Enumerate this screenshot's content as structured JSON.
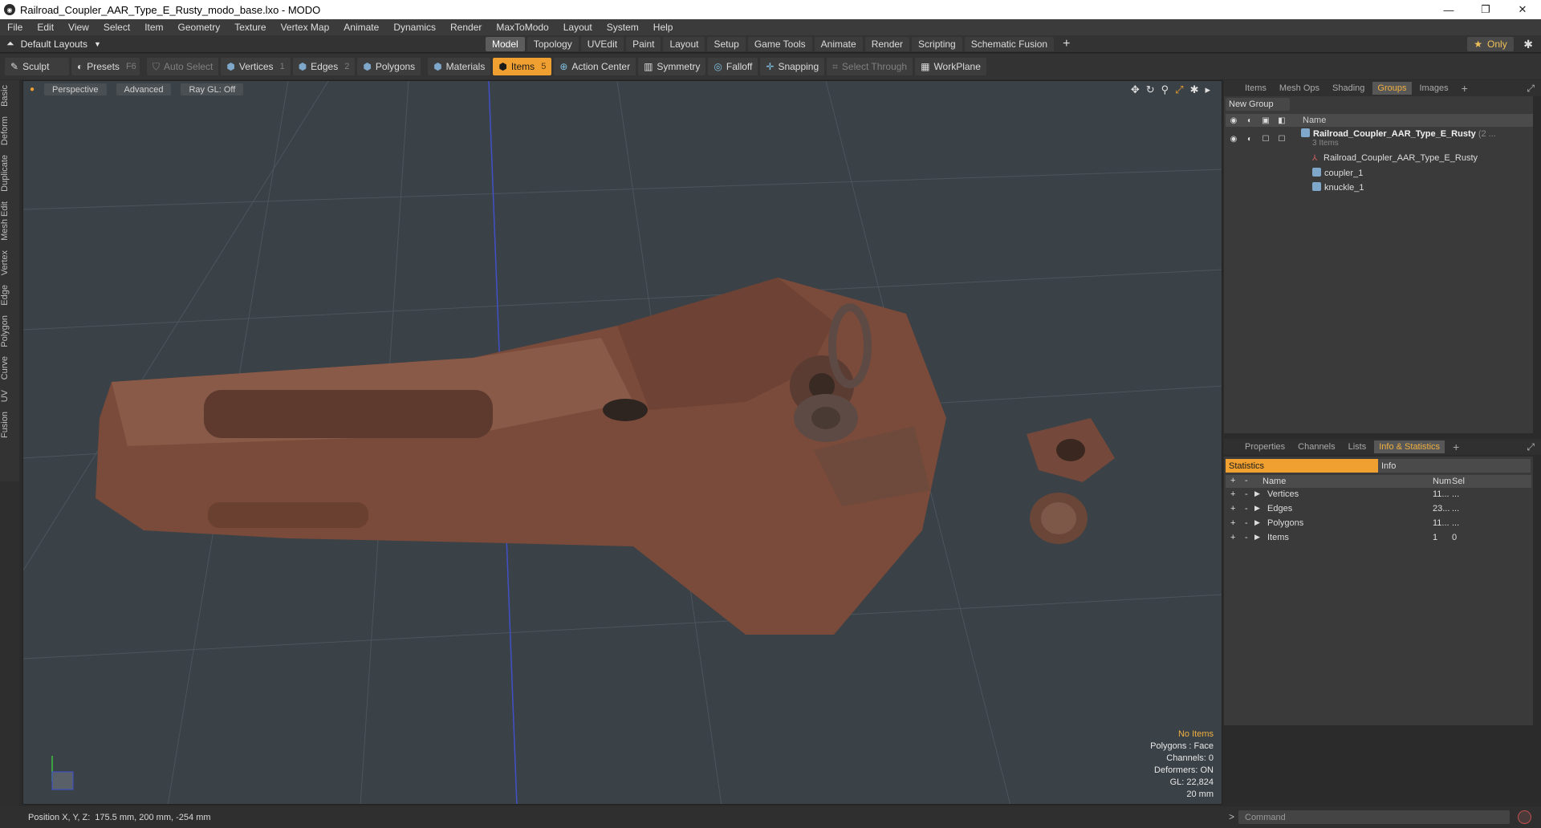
{
  "window": {
    "title": "Railroad_Coupler_AAR_Type_E_Rusty_modo_base.lxo - MODO",
    "app_icon": "modo-icon"
  },
  "menu": [
    "File",
    "Edit",
    "View",
    "Select",
    "Item",
    "Geometry",
    "Texture",
    "Vertex Map",
    "Animate",
    "Dynamics",
    "Render",
    "MaxToModo",
    "Layout",
    "System",
    "Help"
  ],
  "layout_bar": {
    "layout_name": "Default Layouts",
    "tabs": [
      "Model",
      "Topology",
      "UVEdit",
      "Paint",
      "Layout",
      "Setup",
      "Game Tools",
      "Animate",
      "Render",
      "Scripting",
      "Schematic Fusion"
    ],
    "active_tab": "Model",
    "only_label": "Only"
  },
  "toolbar": {
    "sculpt": "Sculpt",
    "presets": "Presets",
    "presets_key": "F6",
    "auto_select": "Auto Select",
    "vertices": "Vertices",
    "vertices_key": "1",
    "edges": "Edges",
    "edges_key": "2",
    "polygons": "Polygons",
    "materials": "Materials",
    "items": "Items",
    "items_key": "5",
    "action_center": "Action Center",
    "symmetry": "Symmetry",
    "falloff": "Falloff",
    "snapping": "Snapping",
    "select_through": "Select Through",
    "workplane": "WorkPlane"
  },
  "left_tabs": [
    "Basic",
    "Deform",
    "Duplicate",
    "Mesh Edit",
    "Vertex",
    "Edge",
    "Polygon",
    "Curve",
    "UV",
    "Fusion"
  ],
  "viewport": {
    "view": "Perspective",
    "shading": "Advanced",
    "raygl": "Ray GL: Off",
    "info": {
      "no_items": "No Items",
      "polygons": "Polygons : Face",
      "channels": "Channels: 0",
      "deformers": "Deformers: ON",
      "gl": "GL: 22,824",
      "scale": "20 mm"
    }
  },
  "status": {
    "label": "Position X, Y, Z:",
    "value": "175.5 mm, 200 mm, -254 mm"
  },
  "groups_panel": {
    "tabs": [
      "Items",
      "Mesh Ops",
      "Shading",
      "Groups",
      "Images"
    ],
    "active_tab": "Groups",
    "new_group": "New Group",
    "name_header": "Name",
    "root_name": "Railroad_Coupler_AAR_Type_E_Rusty",
    "root_suffix": "(2 ...",
    "root_count": "3 Items",
    "children": [
      "Railroad_Coupler_AAR_Type_E_Rusty",
      "coupler_1",
      "knuckle_1"
    ]
  },
  "stats_panel": {
    "tabs": [
      "Properties",
      "Channels",
      "Lists",
      "Info & Statistics"
    ],
    "active_tab": "Info & Statistics",
    "subtabs": [
      "Statistics",
      "Info"
    ],
    "headers": {
      "name": "Name",
      "num": "Num",
      "sel": "Sel"
    },
    "rows": [
      {
        "name": "Vertices",
        "num": "11...",
        "sel": "..."
      },
      {
        "name": "Edges",
        "num": "23...",
        "sel": "..."
      },
      {
        "name": "Polygons",
        "num": "11...",
        "sel": "..."
      },
      {
        "name": "Items",
        "num": "1",
        "sel": "0"
      }
    ]
  },
  "command": {
    "placeholder": "Command"
  },
  "colors": {
    "accent": "#f0a030",
    "viewport_bg": "#3a4147",
    "rust": "#7a4a3a"
  }
}
